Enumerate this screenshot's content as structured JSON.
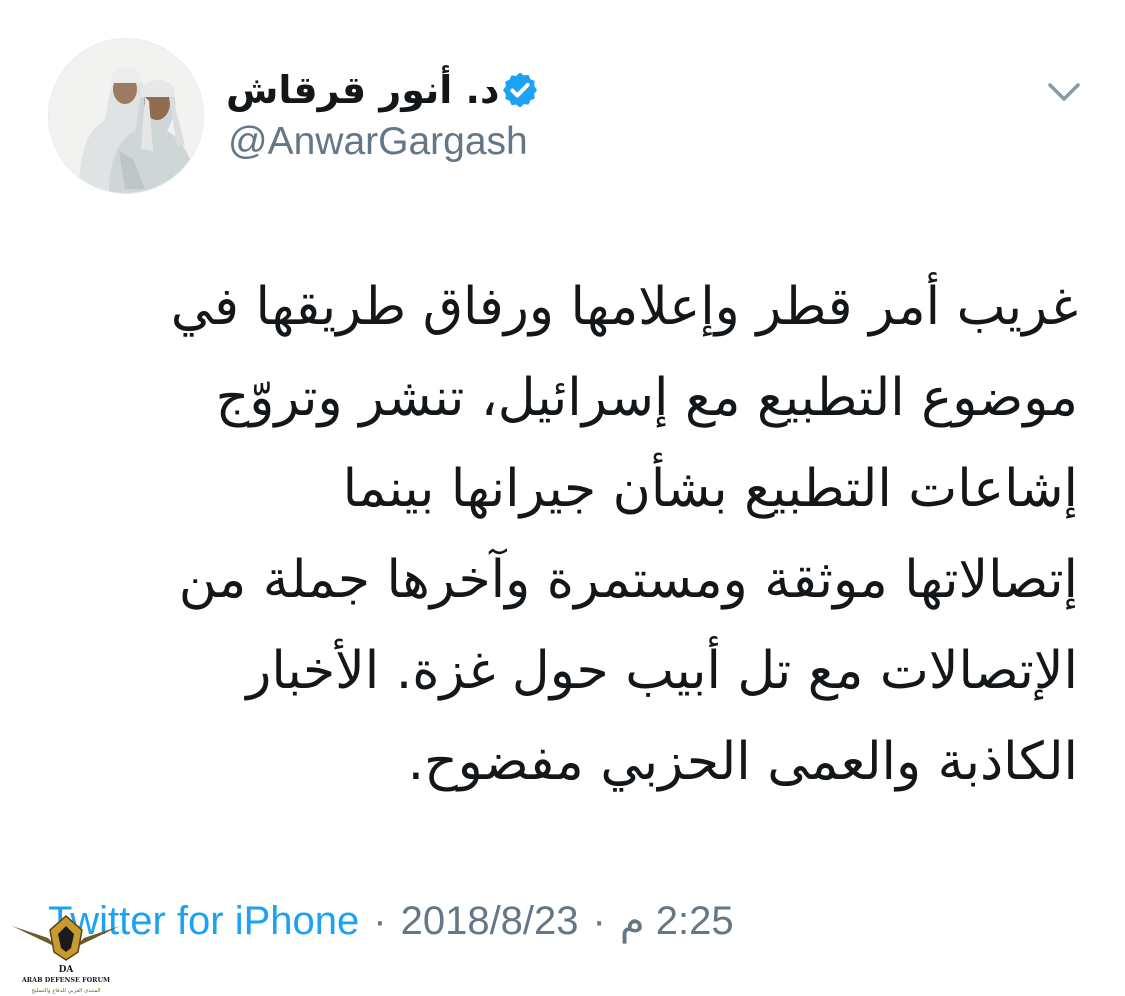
{
  "user": {
    "display_name": "د. أنور قرقاش",
    "handle": "@AnwarGargash",
    "verified_color": "#1da1f2"
  },
  "tweet": {
    "lines": [
      "غريب أمر قطر وإعلامها ورفاق طريقها في",
      "موضوع التطبيع مع إسرائيل، تنشر وتروّج",
      "إشاعات التطبيع بشأن جيرانها بينما",
      "إتصالاتها موثقة ومستمرة وآخرها جملة من",
      "الإتصالات مع تل أبيب حول غزة. الأخبار",
      "الكاذبة والعمى الحزبي مفضوح."
    ]
  },
  "meta": {
    "source": "Twitter for iPhone",
    "separator": "·",
    "date": "2018/8/23",
    "time": "2:25 م"
  },
  "icons": {
    "verified": "verified-badge-icon",
    "menu": "chevron-down-icon",
    "watermark": "arab-defense-forum-logo"
  },
  "watermark": {
    "title": "ARAB DEFENSE FORUM",
    "abbr": "DA",
    "subtitle": "المنتدى العربي للدفاع والتسليح"
  },
  "colors": {
    "text": "#14171a",
    "secondary": "#657786",
    "link": "#1da1f2",
    "chevron": "#8899a6"
  }
}
